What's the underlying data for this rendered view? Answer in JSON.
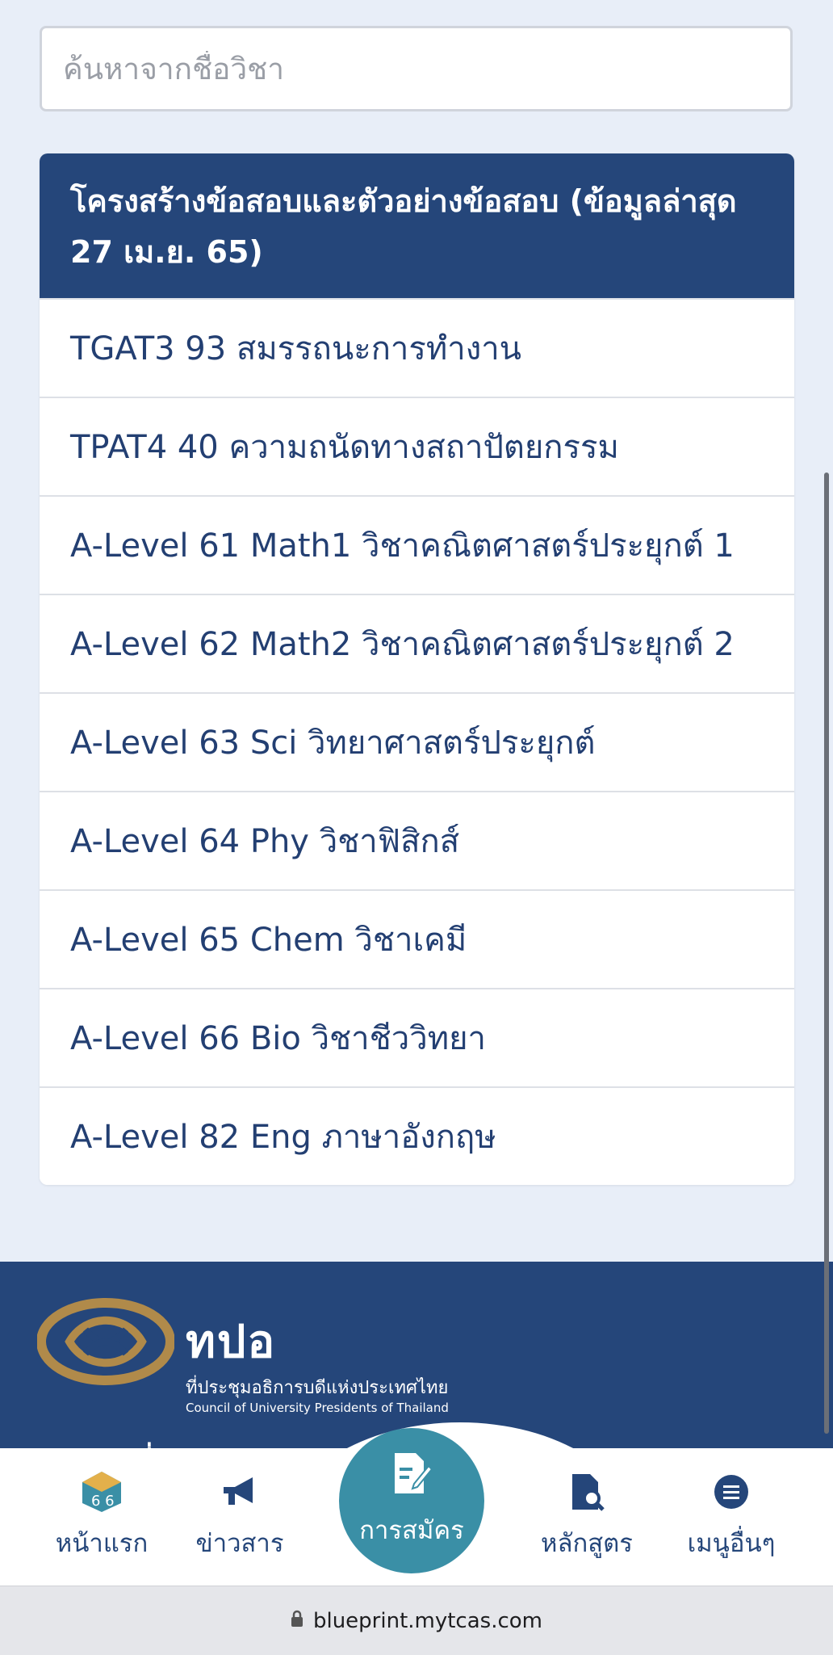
{
  "search": {
    "placeholder": "ค้นหาจากชื่อวิชา"
  },
  "card": {
    "header": "โครงสร้างข้อสอบและตัวอย่างข้อสอบ (ข้อมูลล่าสุด 27 เม.ย. 65)",
    "items": [
      "TGAT3 93 สมรรถนะการทำงาน",
      "TPAT4 40 ความถนัดทางสถาปัตยกรรม",
      "A-Level 61 Math1 วิชาคณิตศาสตร์ประยุกต์ 1",
      "A-Level 62 Math2 วิชาคณิตศาสตร์ประยุกต์ 2",
      "A-Level 63 Sci วิทยาศาสตร์ประยุกต์",
      "A-Level 64 Phy วิชาฟิสิกส์",
      "A-Level 65 Chem วิชาเคมี",
      "A-Level 66 Bio วิชาชีววิทยา",
      "A-Level 82 Eng ภาษาอังกฤษ"
    ]
  },
  "footer": {
    "logo_big": "ทปอ",
    "logo_th": "ที่ประชุมอธิการบดีแห่งประเทศไทย",
    "logo_en": "Council of University Presidents of Thailand",
    "line": "สมาคมที่ประชุมอธิการบดีแห่งประเทศไทย"
  },
  "nav": {
    "home": "หน้าแรก",
    "news": "ข่าวสาร",
    "apply": "การสมัคร",
    "programs": "หลักสูตร",
    "more": "เมนูอื่นๆ",
    "home_badge": "6 6"
  },
  "browser": {
    "url": "blueprint.mytcas.com"
  },
  "colors": {
    "primary": "#25467a",
    "accent": "#3a8fa6",
    "logo_gold": "#b08a4a"
  }
}
